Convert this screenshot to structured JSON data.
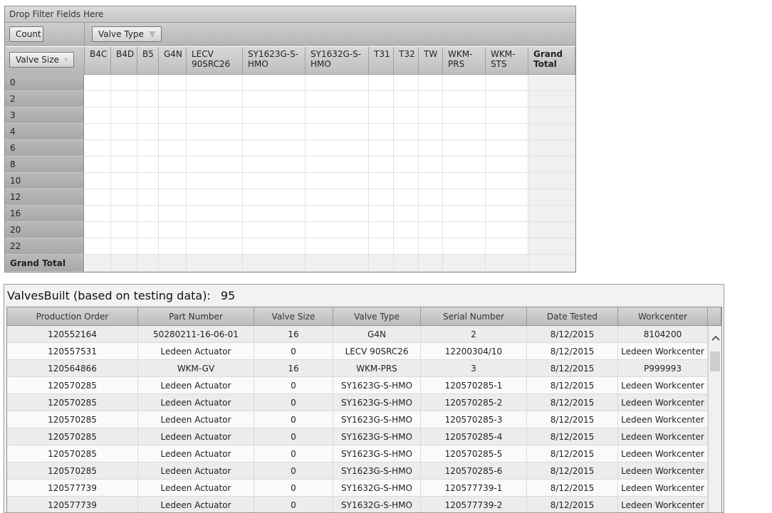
{
  "pivot": {
    "filter_prompt": "Drop Filter Fields Here",
    "data_field": "Count",
    "column_field": "Valve Type",
    "row_field": "Valve Size",
    "columns": [
      {
        "label": "B4C"
      },
      {
        "label": "B4D"
      },
      {
        "label": "B5"
      },
      {
        "label": "G4N"
      },
      {
        "label": "LECV 90SRC26"
      },
      {
        "label": "SY1623G-S-HMO"
      },
      {
        "label": "SY1632G-S-HMO"
      },
      {
        "label": "T31"
      },
      {
        "label": "T32"
      },
      {
        "label": "TW"
      },
      {
        "label": "WKM-PRS"
      },
      {
        "label": "WKM-STS"
      },
      {
        "label": "Grand Total"
      }
    ],
    "rows": [
      "0",
      "2",
      "3",
      "4",
      "6",
      "8",
      "10",
      "12",
      "16",
      "20",
      "22"
    ],
    "grand_total_label": "Grand Total"
  },
  "built": {
    "title": "ValvesBuilt (based on testing data):",
    "count": "95",
    "columns": [
      "Production Order",
      "Part Number",
      "Valve Size",
      "Valve Type",
      "Serial Number",
      "Date Tested",
      "Workcenter"
    ],
    "rows": [
      [
        "120552164",
        "50280211-16-06-01",
        "16",
        "G4N",
        "2",
        "8/12/2015",
        "8104200"
      ],
      [
        "120557531",
        "Ledeen Actuator",
        "0",
        "LECV 90SRC26",
        "12200304/10",
        "8/12/2015",
        "Ledeen Workcenter"
      ],
      [
        "120564866",
        "WKM-GV",
        "16",
        "WKM-PRS",
        "3",
        "8/12/2015",
        "P999993"
      ],
      [
        "120570285",
        "Ledeen Actuator",
        "0",
        "SY1623G-S-HMO",
        "120570285-1",
        "8/12/2015",
        "Ledeen Workcenter"
      ],
      [
        "120570285",
        "Ledeen Actuator",
        "0",
        "SY1623G-S-HMO",
        "120570285-2",
        "8/12/2015",
        "Ledeen Workcenter"
      ],
      [
        "120570285",
        "Ledeen Actuator",
        "0",
        "SY1623G-S-HMO",
        "120570285-3",
        "8/12/2015",
        "Ledeen Workcenter"
      ],
      [
        "120570285",
        "Ledeen Actuator",
        "0",
        "SY1623G-S-HMO",
        "120570285-4",
        "8/12/2015",
        "Ledeen Workcenter"
      ],
      [
        "120570285",
        "Ledeen Actuator",
        "0",
        "SY1623G-S-HMO",
        "120570285-5",
        "8/12/2015",
        "Ledeen Workcenter"
      ],
      [
        "120570285",
        "Ledeen Actuator",
        "0",
        "SY1623G-S-HMO",
        "120570285-6",
        "8/12/2015",
        "Ledeen Workcenter"
      ],
      [
        "120577739",
        "Ledeen Actuator",
        "0",
        "SY1632G-S-HMO",
        "120577739-1",
        "8/12/2015",
        "Ledeen Workcenter"
      ],
      [
        "120577739",
        "Ledeen Actuator",
        "0",
        "SY1632G-S-HMO",
        "120577739-2",
        "8/12/2015",
        "Ledeen Workcenter"
      ]
    ]
  },
  "icons": {
    "filter": "funnel-icon",
    "scroll_up": "chevron-up-icon"
  }
}
